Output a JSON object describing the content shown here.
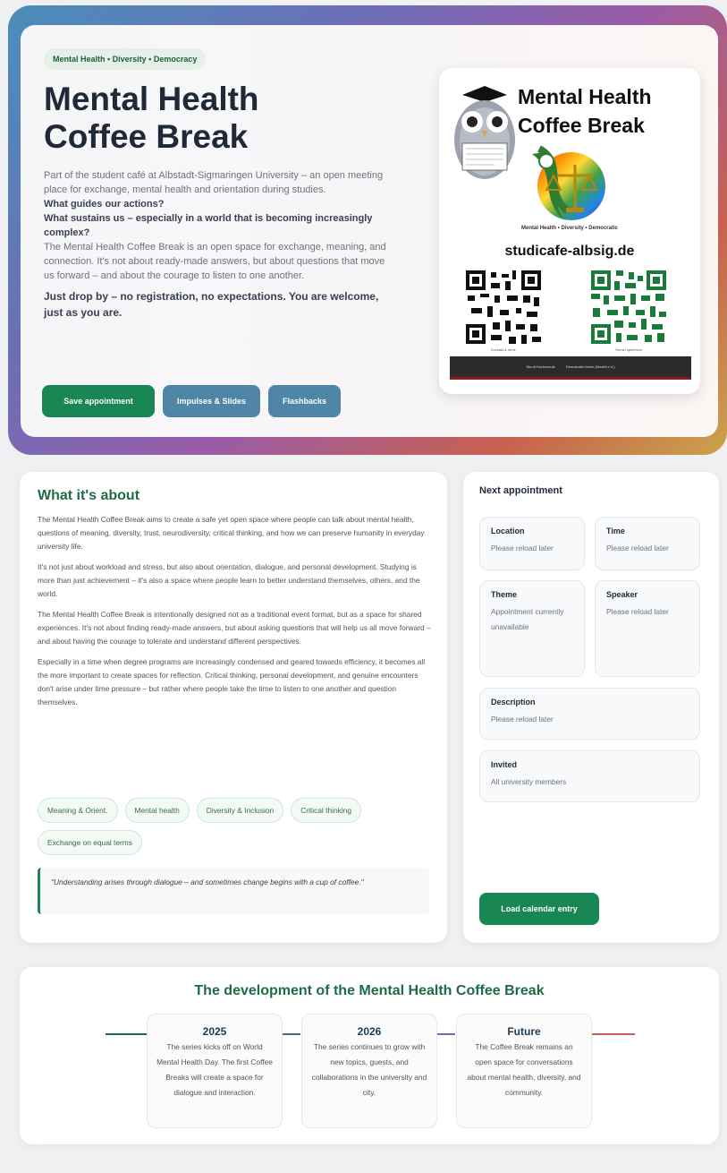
{
  "hero": {
    "badge": "Mental Health • Diversity • Democracy",
    "title": "Mental Health Coffee Break",
    "intro": "Part of the student café at Albstadt-Sigmaringen University – an open meeting place for exchange, mental health and orientation during studies.",
    "question1": "What guides our actions?",
    "question2": "What sustains us – especially in a world that is becoming increasingly complex?",
    "description": "The Mental Health Coffee Break is an open space for exchange, meaning, and connection. It's not about ready-made answers, but about questions that move us forward – and about the courage to listen to one another.",
    "drop_by": "Just drop by – no registration, no expectations. You are welcome, just as you are.",
    "buttons": {
      "save": "Save appointment",
      "impulses": "Impulses & Slides",
      "flashbacks": "Flashbacks"
    }
  },
  "poster": {
    "title": "Mental Health Coffee Break",
    "subtitle": "Mental Health • Diversity • Democratic",
    "url": "studicafe-albsig.de",
    "qr_left_label": "Kontakt & Infos",
    "qr_right_label": "Termin speichern",
    "footer_left": "Sta.dt.Hochschule",
    "footer_right": "Demokratie leben (Modell e.V.)"
  },
  "about": {
    "title": "What it's about",
    "paragraphs": [
      "The Mental Health Coffee Break aims to create a safe yet open space where people can talk about mental health, questions of meaning, diversity, trust, neurodiversity, critical thinking, and how we can preserve humanity in everyday university life.",
      "It's not just about workload and stress, but also about orientation, dialogue, and personal development. Studying is more than just achievement – it's also a space where people learn to better understand themselves, others, and the world.",
      "The Mental Health Coffee Break is intentionally designed not as a traditional event format, but as a space for shared experiences. It's not about finding ready-made answers, but about asking questions that will help us all move forward – and about having the courage to tolerate and understand different perspectives.",
      "Especially in a time when degree programs are increasingly condensed and geared towards efficiency, it becomes all the more important to create spaces for reflection. Critical thinking, personal development, and genuine encounters don't arise under time pressure – but rather where people take the time to listen to one another and question themselves."
    ],
    "tags": [
      "Meaning & Orient.",
      "Mental health",
      "Diversity & Inclusion",
      "Critical thinking",
      "Exchange on equal terms"
    ],
    "quote": "\"Understanding arises through dialogue – and sometimes change begins with a cup of coffee.\""
  },
  "next": {
    "title": "Next appointment",
    "location_label": "Location",
    "location_value": "Please reload later",
    "time_label": "Time",
    "time_value": "Please reload later",
    "theme_label": "Theme",
    "theme_value": "Appointment currently unavailable",
    "speaker_label": "Speaker",
    "speaker_value": "Please reload later",
    "description_label": "Description",
    "description_value": "Please reload later",
    "invited_label": "Invited",
    "invited_value": "All university members",
    "load_button": "Load calendar entry"
  },
  "development": {
    "title": "The development of the Mental Health Coffee Break",
    "items": [
      {
        "year": "2025",
        "text": "The series kicks off on World Mental Health Day. The first Coffee Breaks will create a space for dialogue and interaction."
      },
      {
        "year": "2026",
        "text": "The series continues to grow with new topics, guests, and collaborations in the university and city."
      },
      {
        "year": "Future",
        "text": "The Coffee Break remains an open space for conversations about mental health, diversity, and community."
      }
    ]
  },
  "colors": {
    "accent_green": "#198754",
    "accent_blue": "#4f86a8",
    "heading_green": "#1f6b45"
  }
}
